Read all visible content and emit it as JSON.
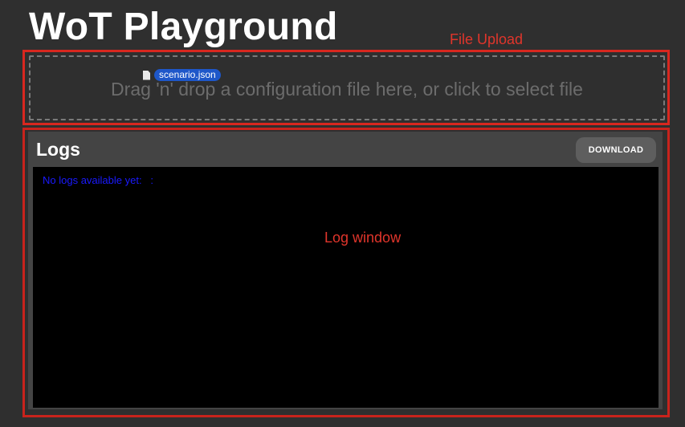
{
  "app": {
    "title": "WoT Playground"
  },
  "annotations": {
    "file_upload": "File Upload",
    "log_window": "Log window",
    "color": "#e0352b"
  },
  "dropzone": {
    "text": "Drag 'n' drop a configuration file here, or click to select file",
    "dragged_file": "scenario.json",
    "file_icon": "document-icon"
  },
  "logs": {
    "title": "Logs",
    "download_label": "DOWNLOAD",
    "empty_message": "No logs available yet:   :"
  },
  "colors": {
    "background": "#2f2f2f",
    "panel": "#444444",
    "log_background": "#000000",
    "log_text": "#1a1aff",
    "drag_pill": "#1e57c9"
  }
}
